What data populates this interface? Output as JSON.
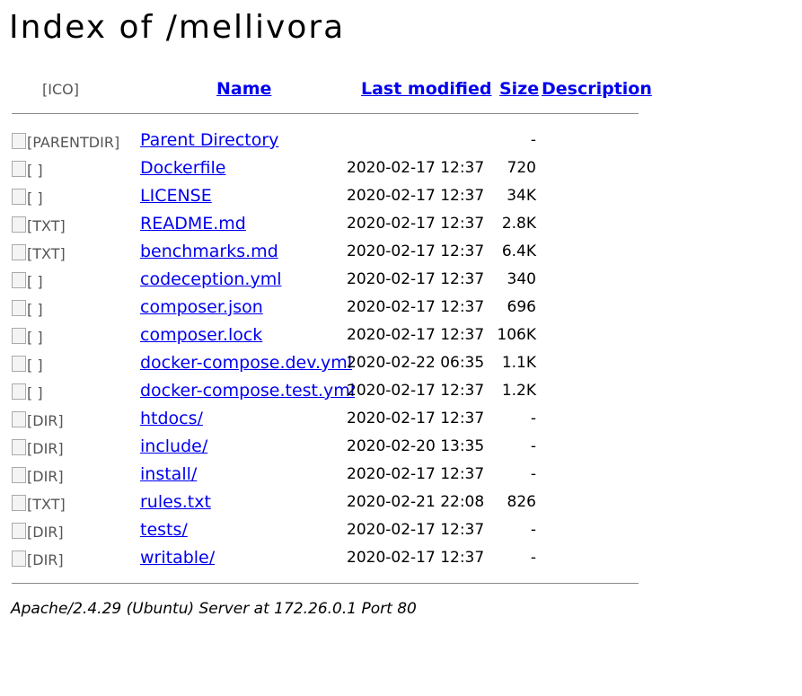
{
  "title": "Index of /mellivora",
  "header": {
    "icon_alt": "[ICO]",
    "name": "Name",
    "last_modified": "Last modified",
    "size": "Size",
    "description": "Description"
  },
  "rows": [
    {
      "icon_alt": "[PARENTDIR]",
      "name": "Parent Directory",
      "date": "",
      "size": "-"
    },
    {
      "icon_alt": "[ ]",
      "name": "Dockerfile",
      "date": "2020-02-17 12:37",
      "size": "720"
    },
    {
      "icon_alt": "[ ]",
      "name": "LICENSE",
      "date": "2020-02-17 12:37",
      "size": "34K"
    },
    {
      "icon_alt": "[TXT]",
      "name": "README.md",
      "date": "2020-02-17 12:37",
      "size": "2.8K"
    },
    {
      "icon_alt": "[TXT]",
      "name": "benchmarks.md",
      "date": "2020-02-17 12:37",
      "size": "6.4K"
    },
    {
      "icon_alt": "[ ]",
      "name": "codeception.yml",
      "date": "2020-02-17 12:37",
      "size": "340"
    },
    {
      "icon_alt": "[ ]",
      "name": "composer.json",
      "date": "2020-02-17 12:37",
      "size": "696"
    },
    {
      "icon_alt": "[ ]",
      "name": "composer.lock",
      "date": "2020-02-17 12:37",
      "size": "106K"
    },
    {
      "icon_alt": "[ ]",
      "name": "docker-compose.dev.yml",
      "date": "2020-02-22 06:35",
      "size": "1.1K"
    },
    {
      "icon_alt": "[ ]",
      "name": "docker-compose.test.yml",
      "date": "2020-02-17 12:37",
      "size": "1.2K"
    },
    {
      "icon_alt": "[DIR]",
      "name": "htdocs/",
      "date": "2020-02-17 12:37",
      "size": "-"
    },
    {
      "icon_alt": "[DIR]",
      "name": "include/",
      "date": "2020-02-20 13:35",
      "size": "-"
    },
    {
      "icon_alt": "[DIR]",
      "name": "install/",
      "date": "2020-02-17 12:37",
      "size": "-"
    },
    {
      "icon_alt": "[TXT]",
      "name": "rules.txt",
      "date": "2020-02-21 22:08",
      "size": "826"
    },
    {
      "icon_alt": "[DIR]",
      "name": "tests/",
      "date": "2020-02-17 12:37",
      "size": "-"
    },
    {
      "icon_alt": "[DIR]",
      "name": "writable/",
      "date": "2020-02-17 12:37",
      "size": "-"
    }
  ],
  "footer": "Apache/2.4.29 (Ubuntu) Server at 172.26.0.1 Port 80"
}
